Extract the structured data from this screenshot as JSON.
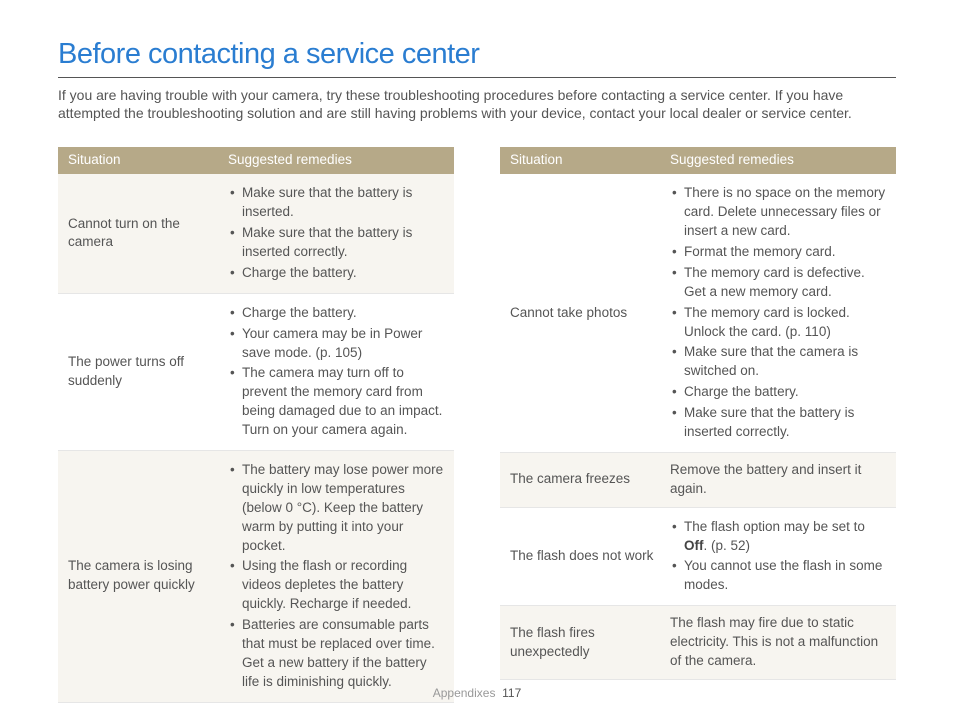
{
  "title": "Before contacting a service center",
  "intro": "If you are having trouble with your camera, try these troubleshooting procedures before contacting a service center. If you have attempted the troubleshooting solution and are still having problems with your device, contact your local dealer or service center.",
  "headers": {
    "situation": "Situation",
    "remedies": "Suggested remedies"
  },
  "left": [
    {
      "shade": true,
      "situation": "Cannot turn on the camera",
      "remedies": [
        "Make sure that the battery is inserted.",
        "Make sure that the battery is inserted correctly.",
        "Charge the battery."
      ]
    },
    {
      "shade": false,
      "situation": "The power turns off suddenly",
      "remedies": [
        "Charge the battery.",
        "Your camera may be in Power save mode. (p. 105)",
        "The camera may turn off to prevent the memory card from being damaged due to an impact. Turn on your camera again."
      ]
    },
    {
      "shade": true,
      "situation": "The camera is losing battery power quickly",
      "remedies": [
        "The battery may lose power more quickly in low temperatures (below 0 °C). Keep the battery warm by putting it into your pocket.",
        "Using the flash or recording videos depletes the battery quickly. Recharge if needed.",
        "Batteries are consumable parts that must be replaced over time. Get a new battery if the battery life is diminishing quickly."
      ]
    }
  ],
  "right": [
    {
      "shade": false,
      "situation": "Cannot take photos",
      "remedies": [
        "There is no space on the memory card. Delete unnecessary files or insert a new card.",
        "Format the memory card.",
        "The memory card is defective. Get a new memory card.",
        "The memory card is locked. Unlock the card. (p. 110)",
        "Make sure that the camera is switched on.",
        "Charge the battery.",
        "Make sure that the battery is inserted correctly."
      ]
    },
    {
      "shade": true,
      "situation": "The camera freezes",
      "remedy_text": "Remove the battery and insert it again."
    },
    {
      "shade": false,
      "situation": "The flash does not work",
      "remedies_html": "flash_off"
    },
    {
      "shade": true,
      "situation": "The flash fires unexpectedly",
      "remedy_text": "The flash may fire due to static electricity. This is not a malfunction of the camera."
    }
  ],
  "flash_off": {
    "line1_pre": "The flash option may be set to ",
    "line1_bold": "Off",
    "line1_post": ". (p. 52)",
    "line2": "You cannot use the flash in some modes."
  },
  "footer": {
    "section": "Appendixes",
    "page": "117"
  }
}
